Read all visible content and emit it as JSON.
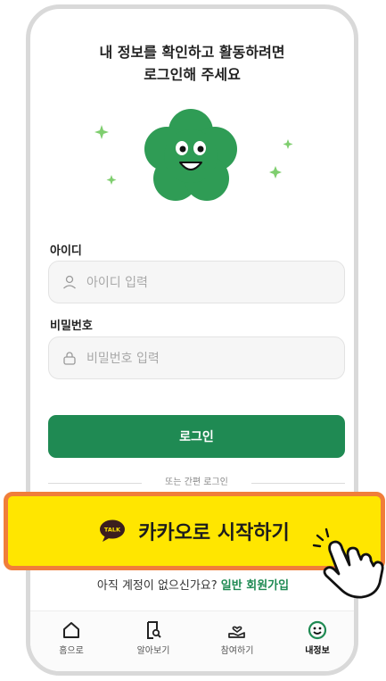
{
  "header": {
    "line1": "내 정보를 확인하고 활동하려면",
    "line2": "로그인해 주세요"
  },
  "id_field": {
    "label": "아이디",
    "placeholder": "아이디 입력"
  },
  "pw_field": {
    "label": "비밀번호",
    "placeholder": "비밀번호 입력"
  },
  "login_button": "로그인",
  "divider_text": "또는 간편 로그인",
  "kakao": {
    "label": "카카오로 시작하기",
    "bubble_text": "TALK",
    "color": "#ffe600",
    "highlight": "#f07e3a"
  },
  "signup": {
    "prompt": "아직 계정이 없으신가요?",
    "link": "일반 회원가입"
  },
  "tabs": [
    {
      "label": "홈으로",
      "icon": "home-icon"
    },
    {
      "label": "알아보기",
      "icon": "search-doc-icon"
    },
    {
      "label": "참여하기",
      "icon": "hand-heart-icon"
    },
    {
      "label": "내정보",
      "icon": "smile-icon",
      "active": true
    }
  ],
  "brand_color": "#1f8a53"
}
